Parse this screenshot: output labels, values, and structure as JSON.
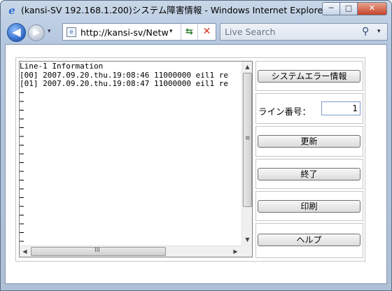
{
  "window": {
    "title": "(kansi-SV 192.168.1.200)システム障害情報 - Windows Internet Explorer",
    "minimize_glyph": "─",
    "maximize_glyph": "□",
    "close_glyph": "✕"
  },
  "nav": {
    "back_glyph": "◀",
    "forward_glyph": "▶",
    "dropdown_glyph": "▾",
    "address": "http://kansi-sv/Netw",
    "refresh_glyph": "⇆",
    "stop_glyph": "✕",
    "search_placeholder": "Live Search",
    "search_glyph": "⚲"
  },
  "log": {
    "lines": "Line-1 Information\n[00] 2007.09.20.thu.19:08:46 11000000 eil1 re\n[01] 2007.09.20.thu.19:08:47 11000000 eil1 re"
  },
  "scroll": {
    "up": "▲",
    "down": "▼",
    "left": "◀",
    "right": "▶",
    "vgrip": "≡",
    "hgrip": "III"
  },
  "panel": {
    "system_error_button": "システムエラー情報",
    "line_number_label": "ライン番号：",
    "line_number_value": "1",
    "update_button": "更新",
    "exit_button": "終了",
    "print_button": "印刷",
    "help_button": "ヘルプ"
  }
}
